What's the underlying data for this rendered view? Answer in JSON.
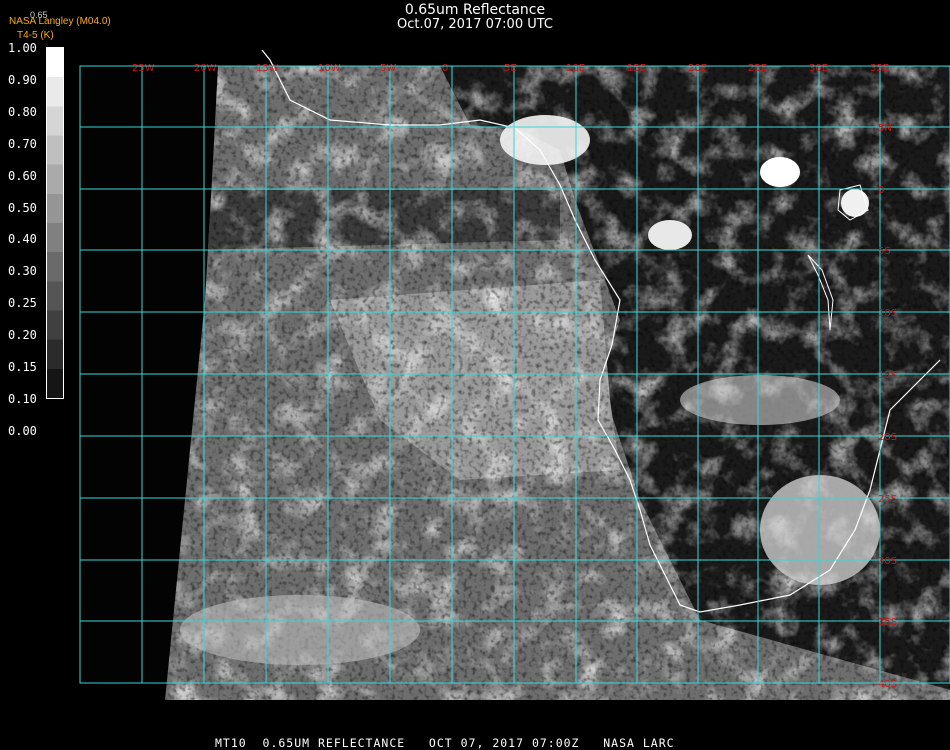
{
  "header": {
    "title": "0.65um Reflectance",
    "datetime": "Oct.07, 2017 07:00 UTC",
    "product_top": "0.65",
    "product": "NASA Langley (M04.0)",
    "product_sub": "T4-5 (K)"
  },
  "colorbar": {
    "labels": [
      "1.00",
      "0.90",
      "0.80",
      "0.70",
      "0.60",
      "0.50",
      "0.40",
      "0.30",
      "0.25",
      "0.20",
      "0.15",
      "0.10",
      "0.00"
    ]
  },
  "grid": {
    "color": "#39d6d6",
    "label_color": "#c81818",
    "lon_labels": [
      "25W",
      "20W",
      "15W",
      "10W",
      "5W",
      "0",
      "5E",
      "10E",
      "15E",
      "20E",
      "25E",
      "30E",
      "35E"
    ],
    "lat_labels": [
      "5N",
      "0",
      "5S",
      "10S",
      "15S",
      "20S",
      "25S",
      "30S",
      "35S",
      "40S"
    ]
  },
  "footer": {
    "text": "MT10  0.65UM REFLECTANCE   OCT 07, 2017 07:00Z   NASA LARC"
  }
}
